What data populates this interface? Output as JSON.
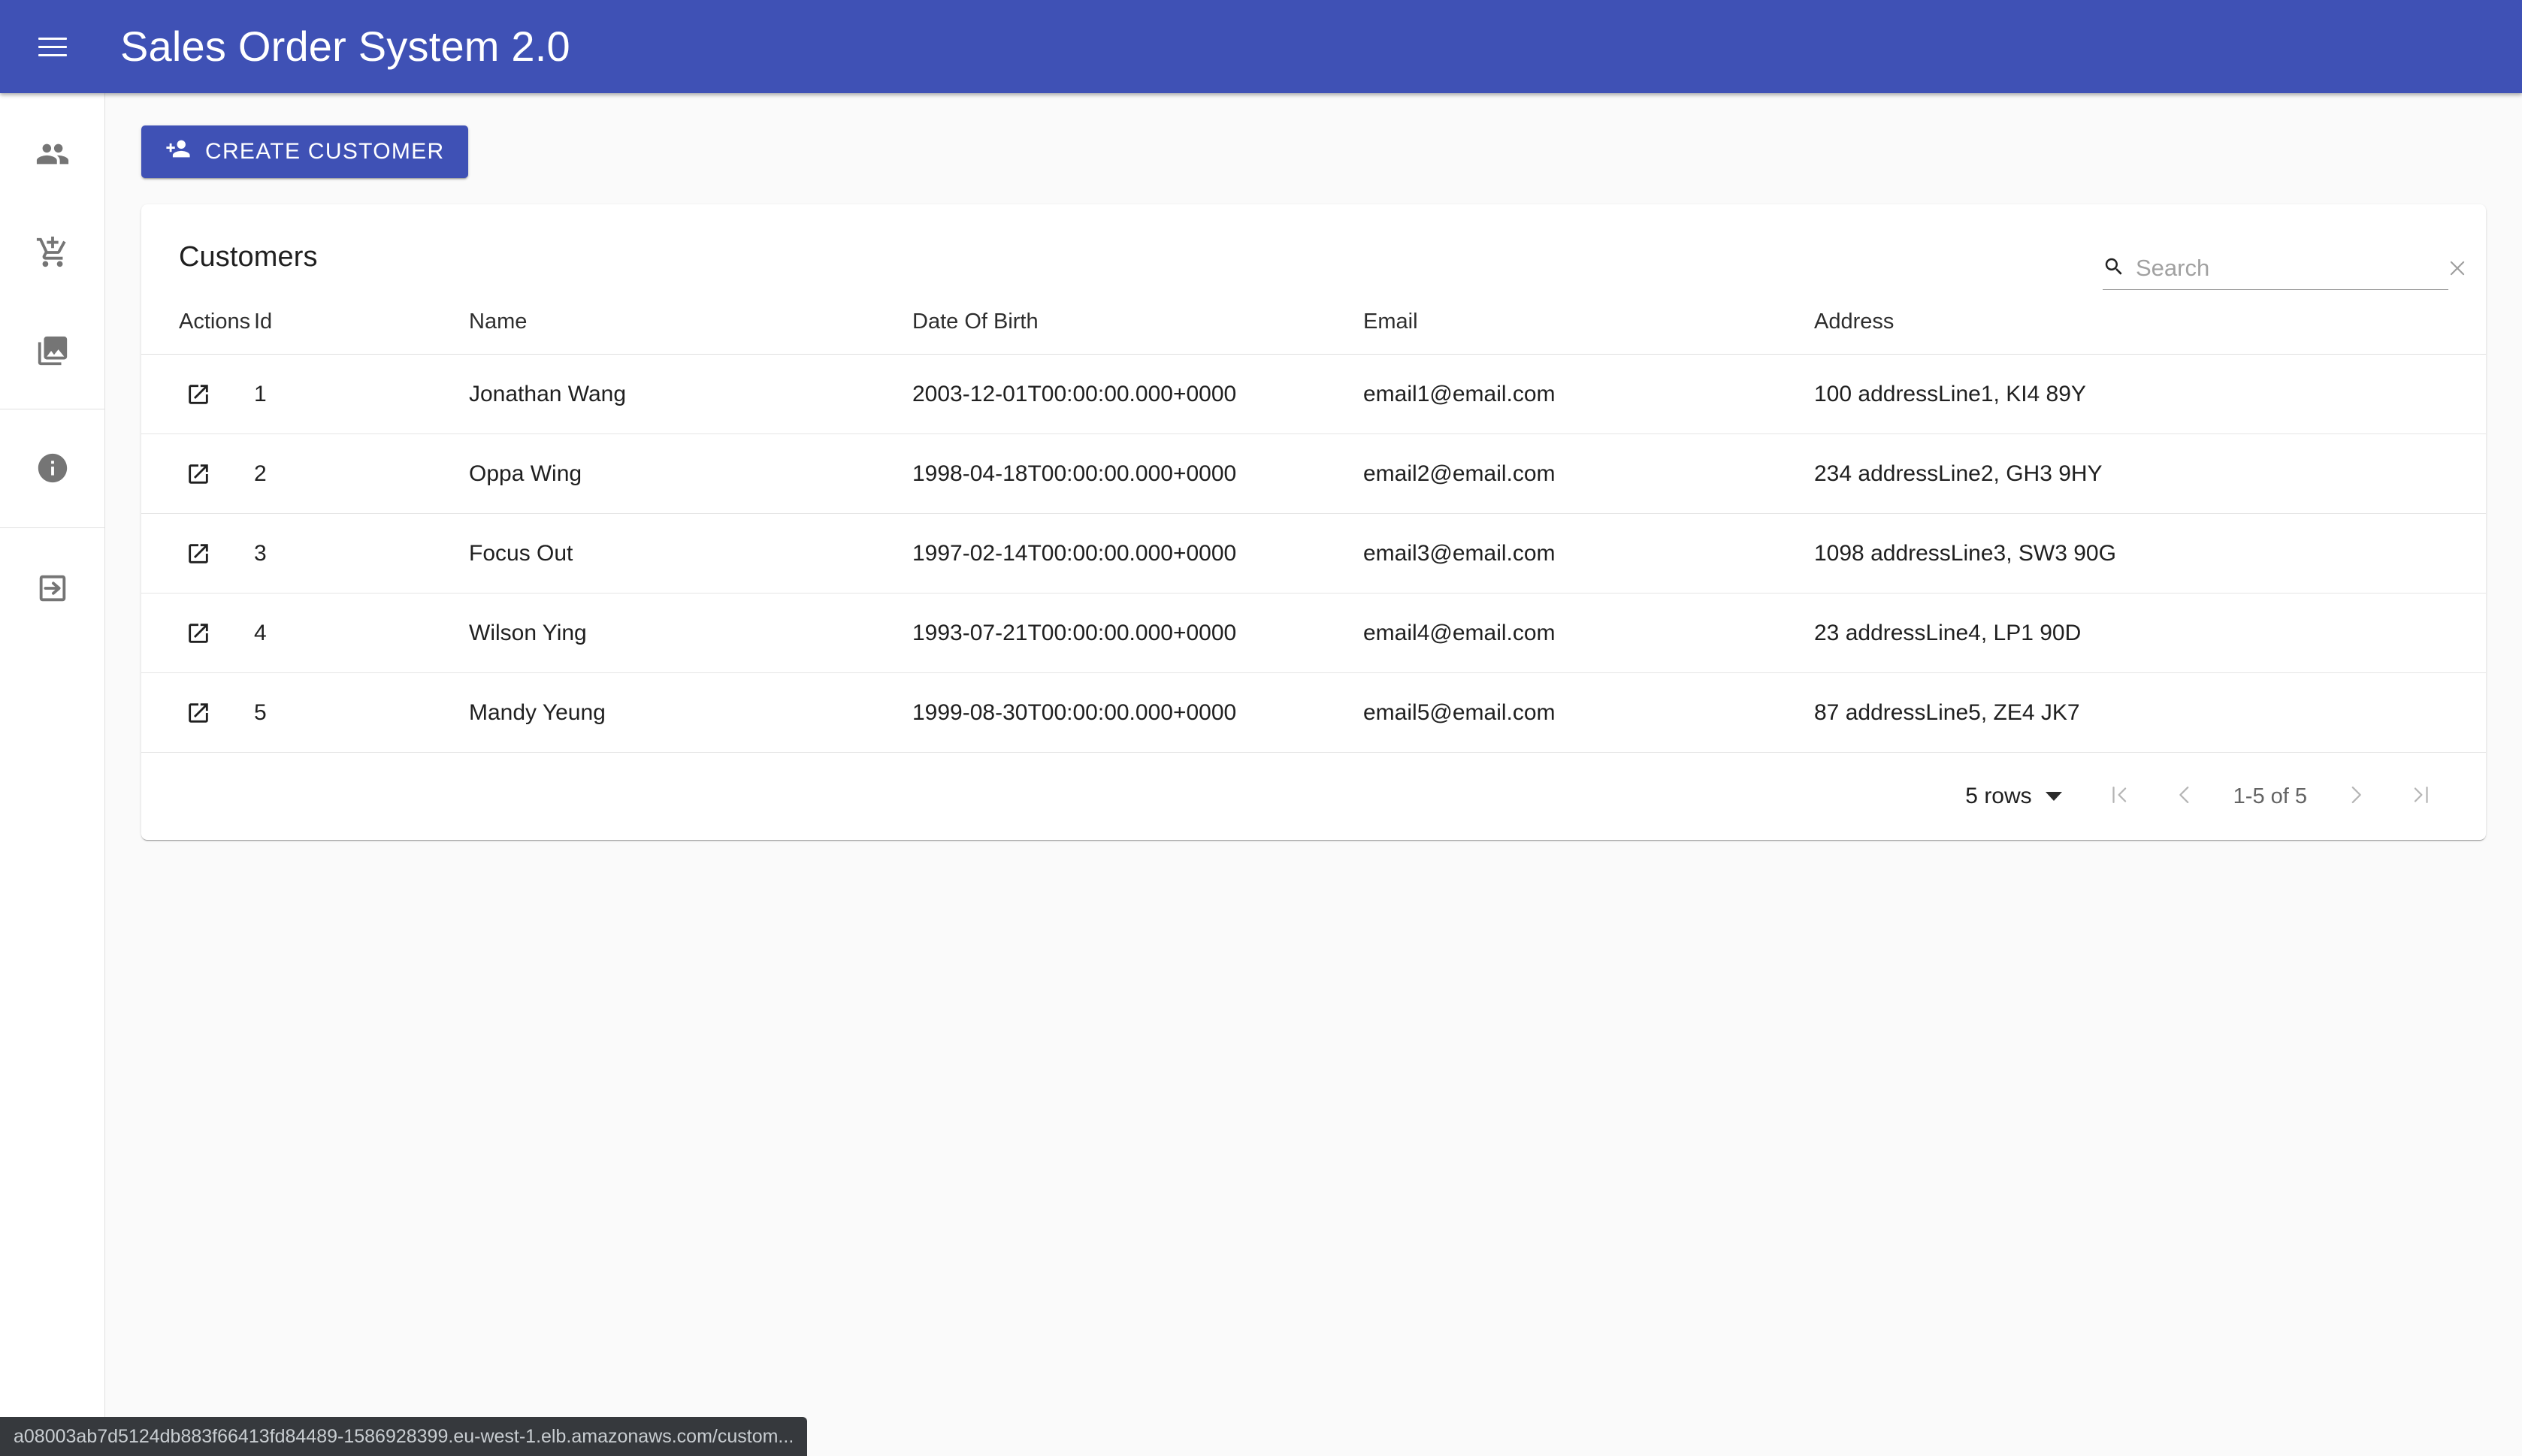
{
  "header": {
    "title": "Sales Order System 2.0",
    "menu_icon": "hamburger-menu-icon",
    "background_color": "#3f51b5"
  },
  "sidebar": {
    "items": [
      {
        "icon": "people-icon",
        "name": "customers"
      },
      {
        "icon": "add-shopping-cart-icon",
        "name": "orders"
      },
      {
        "icon": "photo-library-icon",
        "name": "products"
      },
      {
        "icon": "info-icon",
        "name": "about"
      },
      {
        "icon": "exit-to-app-icon",
        "name": "login"
      }
    ]
  },
  "toolbar": {
    "create_customer_label": "CREATE CUSTOMER",
    "create_customer_icon": "person-add-icon"
  },
  "card": {
    "title": "Customers",
    "search": {
      "placeholder": "Search",
      "value": "",
      "search_icon": "search-icon",
      "clear_icon": "close-icon"
    }
  },
  "table": {
    "columns": [
      "Actions",
      "Id",
      "Name",
      "Date Of Birth",
      "Email",
      "Address"
    ],
    "row_action_icon": "launch-icon",
    "rows": [
      {
        "id": "1",
        "name": "Jonathan Wang",
        "dob": "2003-12-01T00:00:00.000+0000",
        "email": "email1@email.com",
        "address": "100 addressLine1, KI4 89Y"
      },
      {
        "id": "2",
        "name": "Oppa Wing",
        "dob": "1998-04-18T00:00:00.000+0000",
        "email": "email2@email.com",
        "address": "234 addressLine2, GH3 9HY"
      },
      {
        "id": "3",
        "name": "Focus Out",
        "dob": "1997-02-14T00:00:00.000+0000",
        "email": "email3@email.com",
        "address": "1098 addressLine3, SW3 90G"
      },
      {
        "id": "4",
        "name": "Wilson Ying",
        "dob": "1993-07-21T00:00:00.000+0000",
        "email": "email4@email.com",
        "address": "23 addressLine4, LP1 90D"
      },
      {
        "id": "5",
        "name": "Mandy Yeung",
        "dob": "1999-08-30T00:00:00.000+0000",
        "email": "email5@email.com",
        "address": "87 addressLine5, ZE4 JK7"
      }
    ]
  },
  "pagination": {
    "rows_per_page_label": "5 rows",
    "range_label": "1-5 of 5",
    "first_page_icon": "first-page-icon",
    "prev_page_icon": "chevron-left-icon",
    "next_page_icon": "chevron-right-icon",
    "last_page_icon": "last-page-icon",
    "dropdown_icon": "caret-down-icon"
  },
  "statusbar": {
    "url": "a08003ab7d5124db883f66413fd84489-1586928399.eu-west-1.elb.amazonaws.com/custom..."
  }
}
